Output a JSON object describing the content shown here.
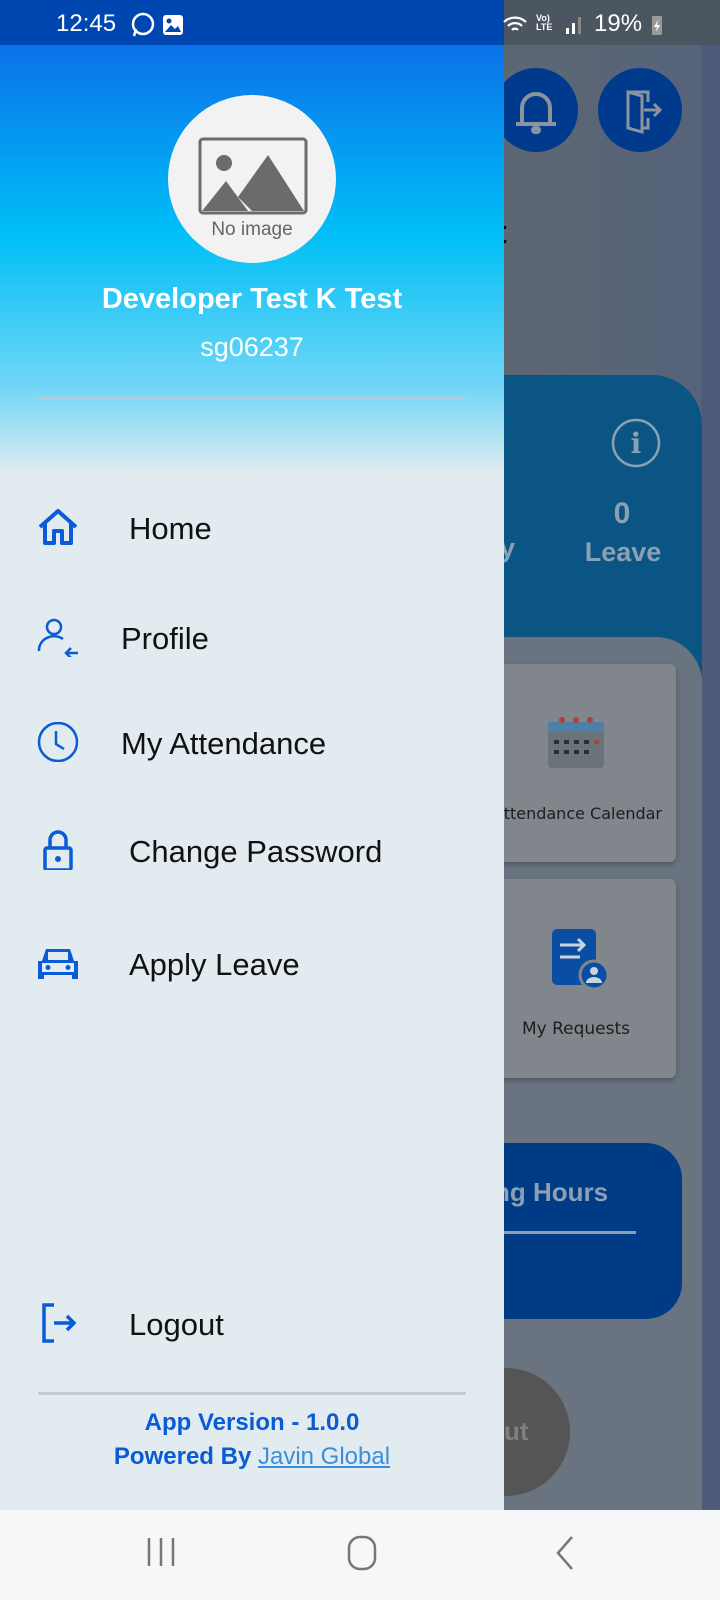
{
  "status_bar": {
    "time": "12:45",
    "battery": "19%",
    "network": "LTE",
    "icons": [
      "whatsapp-icon",
      "gallery-icon",
      "wifi-icon",
      "volte-icon",
      "signal-icon",
      "battery-charging-icon"
    ]
  },
  "drawer": {
    "avatar_placeholder": "No image",
    "user_name": "Developer Test K Test",
    "user_id": "sg06237",
    "items": [
      {
        "label": "Home",
        "icon": "home-icon"
      },
      {
        "label": "Profile",
        "icon": "user-arrow-icon"
      },
      {
        "label": "My Attendance",
        "icon": "clock-icon"
      },
      {
        "label": "Change Password",
        "icon": "lock-icon"
      },
      {
        "label": "Apply Leave",
        "icon": "car-icon"
      }
    ],
    "logout": "Logout",
    "app_version": "App Version - 1.0.0",
    "powered_by": "Powered By",
    "powered_link": "Javin Global",
    "accent": "#0a5bd6"
  },
  "background": {
    "title_fragment": "t",
    "leave_count": "0",
    "leave_label": "Leave",
    "left_fragment": "y",
    "card_calendar": "ttendance Calendar",
    "card_requests": "My Requests",
    "hours_fragment": "ng Hours",
    "button_fragment": "ut"
  }
}
